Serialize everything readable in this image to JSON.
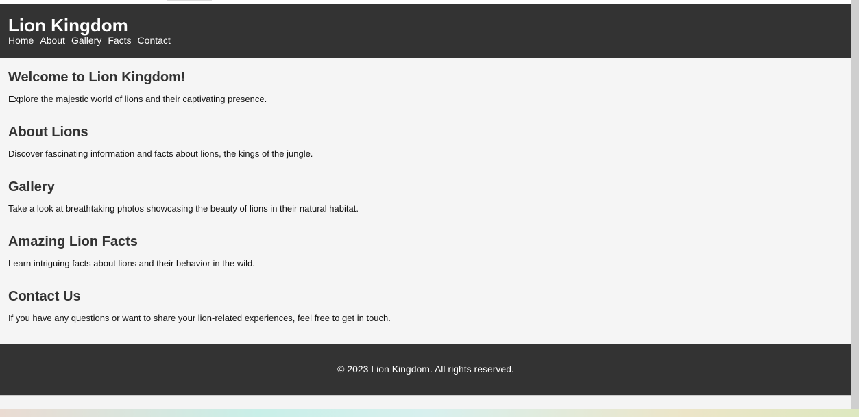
{
  "header": {
    "title": "Lion Kingdom",
    "nav": [
      "Home",
      "About",
      "Gallery",
      "Facts",
      "Contact"
    ]
  },
  "sections": [
    {
      "heading": "Welcome to Lion Kingdom!",
      "text": "Explore the majestic world of lions and their captivating presence."
    },
    {
      "heading": "About Lions",
      "text": "Discover fascinating information and facts about lions, the kings of the jungle."
    },
    {
      "heading": "Gallery",
      "text": "Take a look at breathtaking photos showcasing the beauty of lions in their natural habitat."
    },
    {
      "heading": "Amazing Lion Facts",
      "text": "Learn intriguing facts about lions and their behavior in the wild."
    },
    {
      "heading": "Contact Us",
      "text": "If you have any questions or want to share your lion-related experiences, feel free to get in touch."
    }
  ],
  "footer": {
    "text": "© 2023 Lion Kingdom. All rights reserved."
  }
}
